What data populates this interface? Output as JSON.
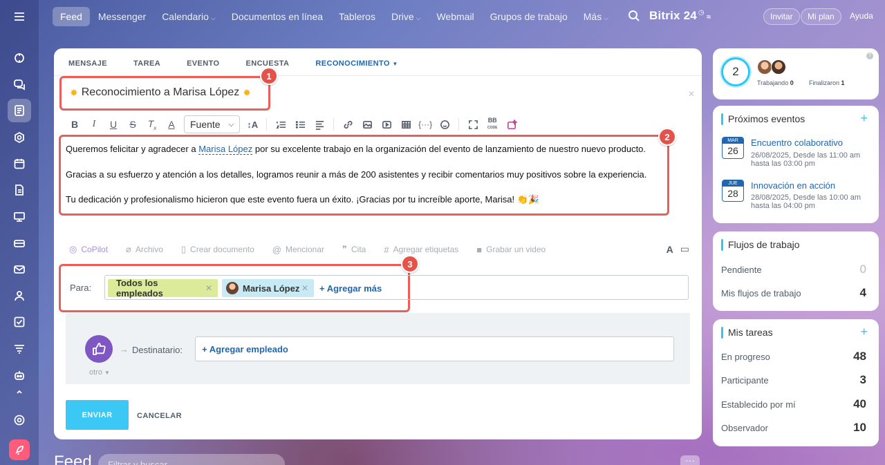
{
  "topbar": {
    "nav": [
      {
        "label": "Feed"
      },
      {
        "label": "Messenger"
      },
      {
        "label": "Calendario"
      },
      {
        "label": "Documentos en línea"
      },
      {
        "label": "Tableros"
      },
      {
        "label": "Drive"
      },
      {
        "label": "Webmail"
      },
      {
        "label": "Grupos de trabajo"
      },
      {
        "label": "Más"
      }
    ],
    "brand": "Bitrix 24",
    "invite": "Invitar",
    "plan": "Mi plan",
    "help": "Ayuda"
  },
  "composer": {
    "tabs": [
      "MENSAJE",
      "TAREA",
      "EVENTO",
      "ENCUESTA",
      "RECONOCIMIENTO"
    ],
    "title": "Reconocimiento a Marisa López",
    "font_select": "Fuente",
    "body": {
      "p1_pre": "Queremos felicitar y agradecer a ",
      "p1_mention": "Marisa López",
      "p1_post": " por su excelente trabajo en la organización del evento de lanzamiento de nuestro nuevo producto.",
      "p2": "Gracias a su esfuerzo y atención a los detalles, logramos reunir a más de 200 asistentes y recibir comentarios muy positivos sobre la experiencia.",
      "p3": "Tu dedicación y profesionalismo hicieron que este evento fuera un éxito. ¡Gracias por tu increíble aporte, Marisa! 👏🎉"
    },
    "actions": [
      "CoPilot",
      "Archivo",
      "Crear documento",
      "Mencionar",
      "Cita",
      "Agregar etiquetas",
      "Grabar un video"
    ],
    "to_label": "Para:",
    "recipients": [
      "Todos los empleados",
      "Marisa López"
    ],
    "add_more": "+ Agregar más",
    "recipient_label": "Destinatario:",
    "add_employee": "+ Agregar empleado",
    "badge_type": "otro",
    "send": "ENVIAR",
    "cancel": "CANCELAR",
    "callouts": [
      "1",
      "2",
      "3"
    ]
  },
  "feed": {
    "title": "Feed",
    "search_placeholder": "Filtrar y buscar"
  },
  "sidebar": {
    "status": {
      "count": "2",
      "working_label": "Trabajando",
      "working_value": "0",
      "finished_label": "Finalizaron",
      "finished_value": "1"
    },
    "events": {
      "title": "Próximos eventos",
      "items": [
        {
          "month": "MAR",
          "day": "26",
          "name": "Encuentro colaborativo",
          "when": "26/08/2025, Desde las 11:00 am hasta las 03:00 pm"
        },
        {
          "month": "JUE",
          "day": "28",
          "name": "Innovación en acción",
          "when": "28/08/2025, Desde las 10:00 am hasta las 04:00 pm"
        }
      ]
    },
    "workflows": {
      "title": "Flujos de trabajo",
      "rows": [
        {
          "label": "Pendiente",
          "value": "0"
        },
        {
          "label": "Mis flujos de trabajo",
          "value": "4"
        }
      ]
    },
    "tasks": {
      "title": "Mis tareas",
      "rows": [
        {
          "label": "En progreso",
          "value": "48"
        },
        {
          "label": "Participante",
          "value": "3"
        },
        {
          "label": "Establecido por mí",
          "value": "40"
        },
        {
          "label": "Observador",
          "value": "10"
        }
      ]
    }
  },
  "colors": {
    "accent": "#2fc6f6",
    "link": "#2067b0",
    "callout": "#e85e5a",
    "send": "#3bc8f5"
  }
}
